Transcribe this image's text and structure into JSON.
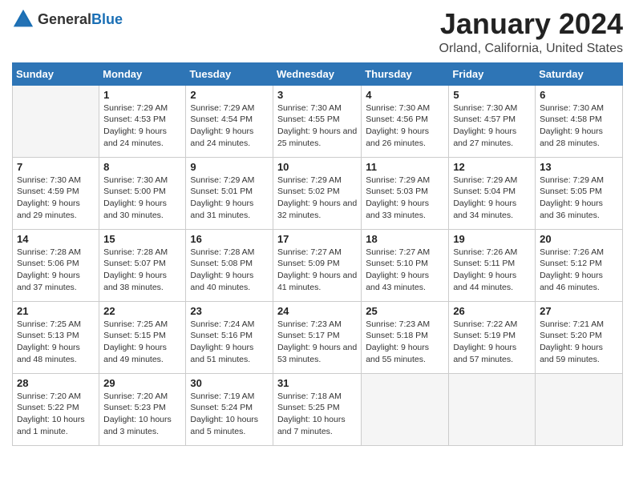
{
  "logo": {
    "text_general": "General",
    "text_blue": "Blue"
  },
  "title": "January 2024",
  "location": "Orland, California, United States",
  "days_of_week": [
    "Sunday",
    "Monday",
    "Tuesday",
    "Wednesday",
    "Thursday",
    "Friday",
    "Saturday"
  ],
  "weeks": [
    [
      {
        "day": "",
        "sunrise": "",
        "sunset": "",
        "daylight": ""
      },
      {
        "day": "1",
        "sunrise": "Sunrise: 7:29 AM",
        "sunset": "Sunset: 4:53 PM",
        "daylight": "Daylight: 9 hours and 24 minutes."
      },
      {
        "day": "2",
        "sunrise": "Sunrise: 7:29 AM",
        "sunset": "Sunset: 4:54 PM",
        "daylight": "Daylight: 9 hours and 24 minutes."
      },
      {
        "day": "3",
        "sunrise": "Sunrise: 7:30 AM",
        "sunset": "Sunset: 4:55 PM",
        "daylight": "Daylight: 9 hours and 25 minutes."
      },
      {
        "day": "4",
        "sunrise": "Sunrise: 7:30 AM",
        "sunset": "Sunset: 4:56 PM",
        "daylight": "Daylight: 9 hours and 26 minutes."
      },
      {
        "day": "5",
        "sunrise": "Sunrise: 7:30 AM",
        "sunset": "Sunset: 4:57 PM",
        "daylight": "Daylight: 9 hours and 27 minutes."
      },
      {
        "day": "6",
        "sunrise": "Sunrise: 7:30 AM",
        "sunset": "Sunset: 4:58 PM",
        "daylight": "Daylight: 9 hours and 28 minutes."
      }
    ],
    [
      {
        "day": "7",
        "sunrise": "Sunrise: 7:30 AM",
        "sunset": "Sunset: 4:59 PM",
        "daylight": "Daylight: 9 hours and 29 minutes."
      },
      {
        "day": "8",
        "sunrise": "Sunrise: 7:30 AM",
        "sunset": "Sunset: 5:00 PM",
        "daylight": "Daylight: 9 hours and 30 minutes."
      },
      {
        "day": "9",
        "sunrise": "Sunrise: 7:29 AM",
        "sunset": "Sunset: 5:01 PM",
        "daylight": "Daylight: 9 hours and 31 minutes."
      },
      {
        "day": "10",
        "sunrise": "Sunrise: 7:29 AM",
        "sunset": "Sunset: 5:02 PM",
        "daylight": "Daylight: 9 hours and 32 minutes."
      },
      {
        "day": "11",
        "sunrise": "Sunrise: 7:29 AM",
        "sunset": "Sunset: 5:03 PM",
        "daylight": "Daylight: 9 hours and 33 minutes."
      },
      {
        "day": "12",
        "sunrise": "Sunrise: 7:29 AM",
        "sunset": "Sunset: 5:04 PM",
        "daylight": "Daylight: 9 hours and 34 minutes."
      },
      {
        "day": "13",
        "sunrise": "Sunrise: 7:29 AM",
        "sunset": "Sunset: 5:05 PM",
        "daylight": "Daylight: 9 hours and 36 minutes."
      }
    ],
    [
      {
        "day": "14",
        "sunrise": "Sunrise: 7:28 AM",
        "sunset": "Sunset: 5:06 PM",
        "daylight": "Daylight: 9 hours and 37 minutes."
      },
      {
        "day": "15",
        "sunrise": "Sunrise: 7:28 AM",
        "sunset": "Sunset: 5:07 PM",
        "daylight": "Daylight: 9 hours and 38 minutes."
      },
      {
        "day": "16",
        "sunrise": "Sunrise: 7:28 AM",
        "sunset": "Sunset: 5:08 PM",
        "daylight": "Daylight: 9 hours and 40 minutes."
      },
      {
        "day": "17",
        "sunrise": "Sunrise: 7:27 AM",
        "sunset": "Sunset: 5:09 PM",
        "daylight": "Daylight: 9 hours and 41 minutes."
      },
      {
        "day": "18",
        "sunrise": "Sunrise: 7:27 AM",
        "sunset": "Sunset: 5:10 PM",
        "daylight": "Daylight: 9 hours and 43 minutes."
      },
      {
        "day": "19",
        "sunrise": "Sunrise: 7:26 AM",
        "sunset": "Sunset: 5:11 PM",
        "daylight": "Daylight: 9 hours and 44 minutes."
      },
      {
        "day": "20",
        "sunrise": "Sunrise: 7:26 AM",
        "sunset": "Sunset: 5:12 PM",
        "daylight": "Daylight: 9 hours and 46 minutes."
      }
    ],
    [
      {
        "day": "21",
        "sunrise": "Sunrise: 7:25 AM",
        "sunset": "Sunset: 5:13 PM",
        "daylight": "Daylight: 9 hours and 48 minutes."
      },
      {
        "day": "22",
        "sunrise": "Sunrise: 7:25 AM",
        "sunset": "Sunset: 5:15 PM",
        "daylight": "Daylight: 9 hours and 49 minutes."
      },
      {
        "day": "23",
        "sunrise": "Sunrise: 7:24 AM",
        "sunset": "Sunset: 5:16 PM",
        "daylight": "Daylight: 9 hours and 51 minutes."
      },
      {
        "day": "24",
        "sunrise": "Sunrise: 7:23 AM",
        "sunset": "Sunset: 5:17 PM",
        "daylight": "Daylight: 9 hours and 53 minutes."
      },
      {
        "day": "25",
        "sunrise": "Sunrise: 7:23 AM",
        "sunset": "Sunset: 5:18 PM",
        "daylight": "Daylight: 9 hours and 55 minutes."
      },
      {
        "day": "26",
        "sunrise": "Sunrise: 7:22 AM",
        "sunset": "Sunset: 5:19 PM",
        "daylight": "Daylight: 9 hours and 57 minutes."
      },
      {
        "day": "27",
        "sunrise": "Sunrise: 7:21 AM",
        "sunset": "Sunset: 5:20 PM",
        "daylight": "Daylight: 9 hours and 59 minutes."
      }
    ],
    [
      {
        "day": "28",
        "sunrise": "Sunrise: 7:20 AM",
        "sunset": "Sunset: 5:22 PM",
        "daylight": "Daylight: 10 hours and 1 minute."
      },
      {
        "day": "29",
        "sunrise": "Sunrise: 7:20 AM",
        "sunset": "Sunset: 5:23 PM",
        "daylight": "Daylight: 10 hours and 3 minutes."
      },
      {
        "day": "30",
        "sunrise": "Sunrise: 7:19 AM",
        "sunset": "Sunset: 5:24 PM",
        "daylight": "Daylight: 10 hours and 5 minutes."
      },
      {
        "day": "31",
        "sunrise": "Sunrise: 7:18 AM",
        "sunset": "Sunset: 5:25 PM",
        "daylight": "Daylight: 10 hours and 7 minutes."
      },
      {
        "day": "",
        "sunrise": "",
        "sunset": "",
        "daylight": ""
      },
      {
        "day": "",
        "sunrise": "",
        "sunset": "",
        "daylight": ""
      },
      {
        "day": "",
        "sunrise": "",
        "sunset": "",
        "daylight": ""
      }
    ]
  ]
}
